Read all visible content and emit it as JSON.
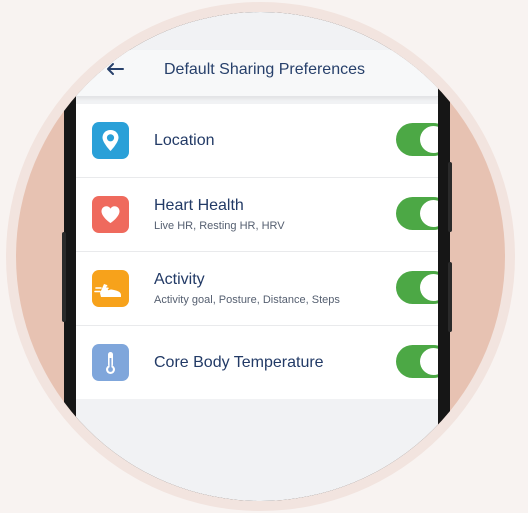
{
  "header": {
    "title": "Default Sharing Preferences",
    "back_icon": "arrow-left-icon"
  },
  "rows": [
    {
      "title": "Location",
      "subtitle": "",
      "icon": "location-pin-icon",
      "icon_color": "#2aa0d8",
      "enabled": true
    },
    {
      "title": "Heart Health",
      "subtitle": "Live HR, Resting HR, HRV",
      "icon": "heart-icon",
      "icon_color": "#ef6a5d",
      "enabled": true
    },
    {
      "title": "Activity",
      "subtitle": "Activity goal, Posture, Distance, Steps",
      "icon": "running-shoe-icon",
      "icon_color": "#f7a21b",
      "enabled": true
    },
    {
      "title": "Core Body Temperature",
      "subtitle": "",
      "icon": "thermometer-icon",
      "icon_color": "#7fa6db",
      "enabled": true
    }
  ],
  "colors": {
    "toggle_on": "#4ca845",
    "title_text": "#223a66",
    "background_ring": "#e7c2b2"
  }
}
